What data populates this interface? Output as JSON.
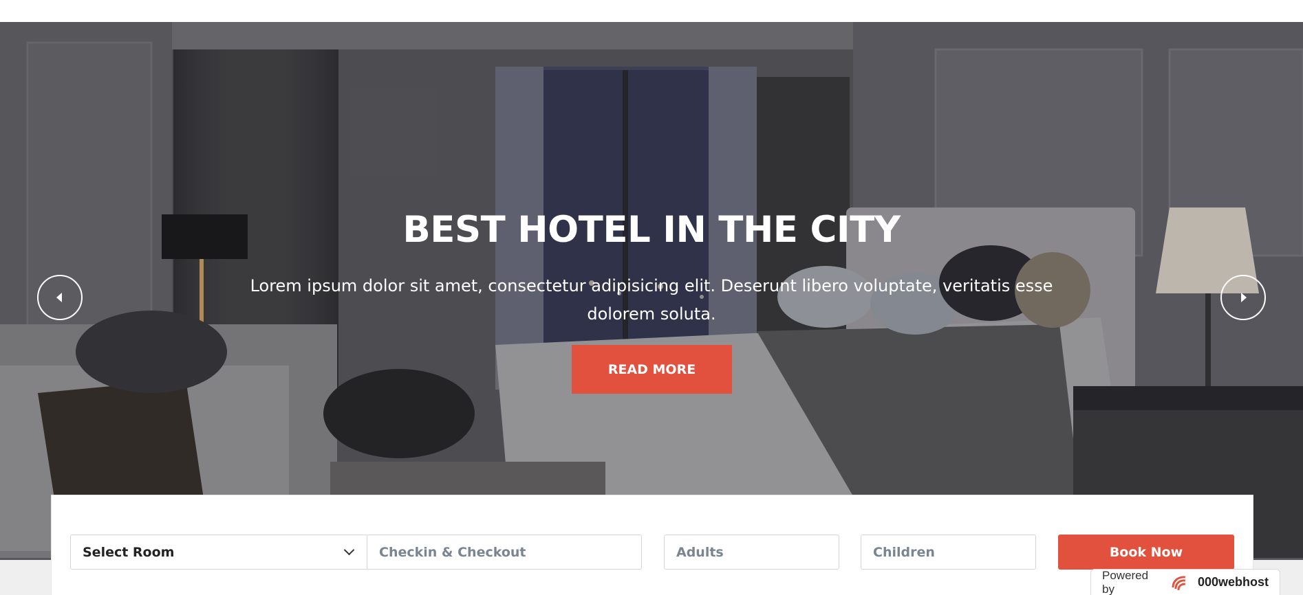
{
  "hero": {
    "title": "BEST HOTEL IN THE CITY",
    "text": "Lorem ipsum dolor sit amet, consectetur adipisicing elit. Deserunt libero voluptate, veritatis esse dolorem soluta.",
    "cta_label": "READ MORE",
    "accent_color": "#e2513e"
  },
  "slider": {
    "prev_icon": "chevron-left-icon",
    "next_icon": "chevron-right-icon"
  },
  "booking": {
    "room_select_value": "Select Room",
    "dates_placeholder": "Checkin & Checkout",
    "adults_placeholder": "Adults",
    "children_placeholder": "Children",
    "book_label": "Book Now"
  },
  "badge": {
    "powered_text": "Powered by",
    "brand": "000webhost"
  }
}
